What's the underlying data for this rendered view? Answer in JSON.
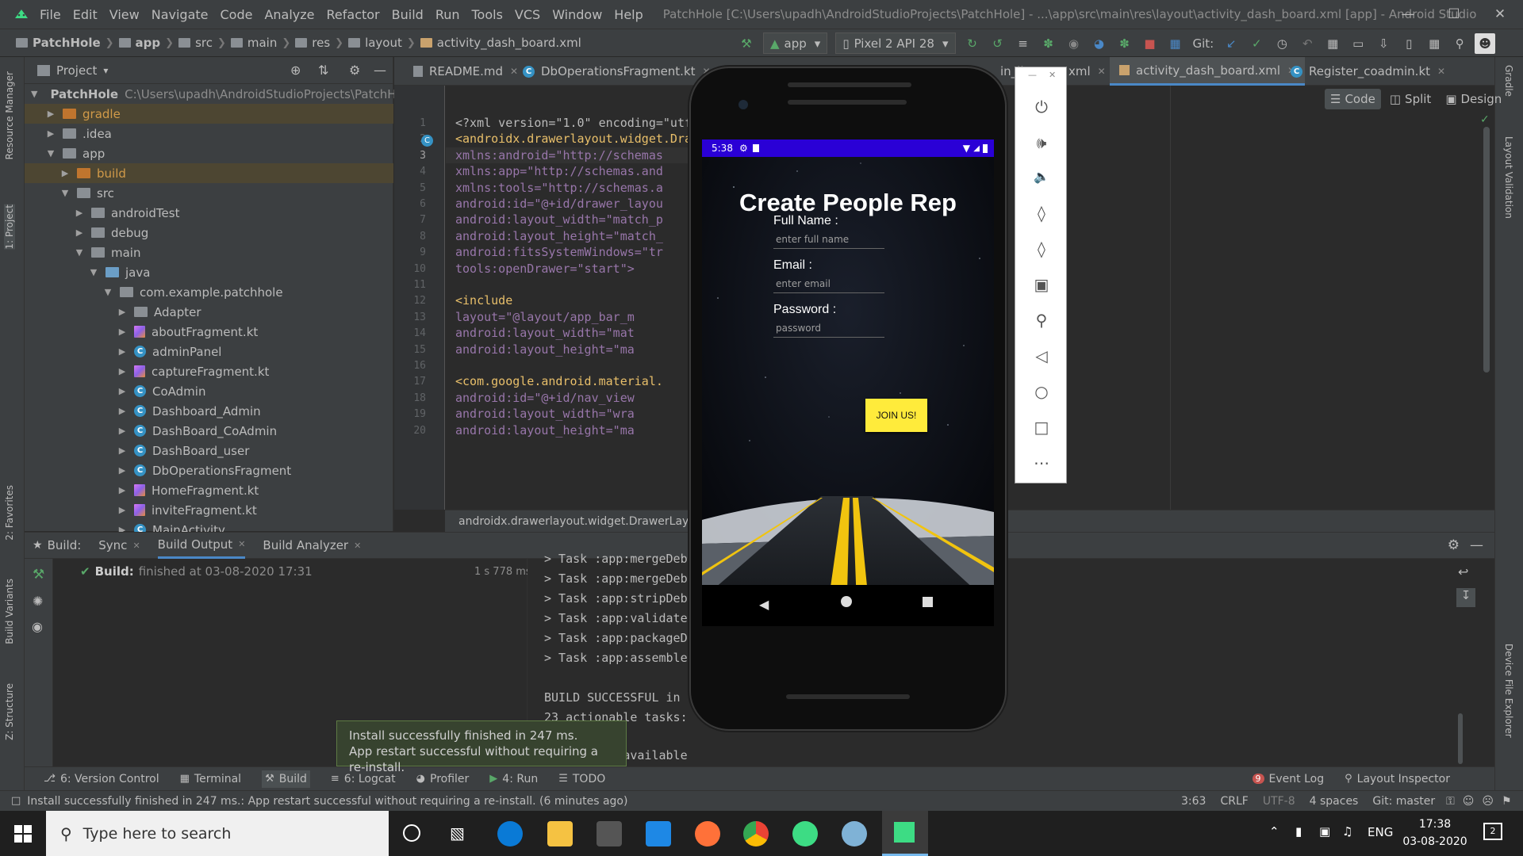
{
  "window": {
    "title": "PatchHole [C:\\Users\\upadh\\AndroidStudioProjects\\PatchHole] - ...\\app\\src\\main\\res\\layout\\activity_dash_board.xml [app] - Android Studio",
    "menu": [
      "File",
      "Edit",
      "View",
      "Navigate",
      "Code",
      "Analyze",
      "Refactor",
      "Build",
      "Run",
      "Tools",
      "VCS",
      "Window",
      "Help"
    ]
  },
  "navbar": {
    "crumbs": [
      "PatchHole",
      "app",
      "src",
      "main",
      "res",
      "layout",
      "activity_dash_board.xml"
    ],
    "run_config": "app",
    "device": "Pixel 2 API 28",
    "git_label": "Git:"
  },
  "left_strip": {
    "resource_manager": "Resource Manager",
    "project": "1: Project",
    "favorites": "2: Favorites",
    "build_variants": "Build Variants",
    "structure": "Z: Structure"
  },
  "right_strip": {
    "gradle": "Gradle",
    "layout_validation": "Layout Validation",
    "device_file_explorer": "Device File Explorer"
  },
  "project_panel": {
    "title": "Project",
    "root_name": "PatchHole",
    "root_path": "C:\\Users\\upadh\\AndroidStudioProjects\\PatchHc",
    "items": [
      {
        "label": "gradle",
        "indent": 1
      },
      {
        "label": ".idea",
        "indent": 1
      },
      {
        "label": "app",
        "indent": 1
      },
      {
        "label": "build",
        "indent": 2
      },
      {
        "label": "src",
        "indent": 2
      },
      {
        "label": "androidTest",
        "indent": 3
      },
      {
        "label": "debug",
        "indent": 3
      },
      {
        "label": "main",
        "indent": 3
      },
      {
        "label": "java",
        "indent": 4
      },
      {
        "label": "com.example.patchhole",
        "indent": 5
      },
      {
        "label": "Adapter",
        "indent": 6
      },
      {
        "label": "aboutFragment.kt",
        "indent": 6
      },
      {
        "label": "adminPanel",
        "indent": 6
      },
      {
        "label": "captureFragment.kt",
        "indent": 6
      },
      {
        "label": "CoAdmin",
        "indent": 6
      },
      {
        "label": "Dashboard_Admin",
        "indent": 6
      },
      {
        "label": "DashBoard_CoAdmin",
        "indent": 6
      },
      {
        "label": "DashBoard_user",
        "indent": 6
      },
      {
        "label": "DbOperationsFragment",
        "indent": 6
      },
      {
        "label": "HomeFragment.kt",
        "indent": 6
      },
      {
        "label": "inviteFragment.kt",
        "indent": 6
      },
      {
        "label": "MainActivity",
        "indent": 6
      }
    ]
  },
  "editor_tabs": [
    {
      "label": "README.md"
    },
    {
      "label": "DbOperationsFragment.kt"
    },
    {
      "label": "in_li"
    },
    {
      "label": "xml"
    },
    {
      "label": "activity_dash_board.xml"
    },
    {
      "label": "Register_coadmin.kt"
    }
  ],
  "view_modes": [
    "Code",
    "Split",
    "Design"
  ],
  "code_lines": [
    {
      "n": "1",
      "text": "<?xml version=\"1.0\" encoding=\"utf"
    },
    {
      "n": "2",
      "text": "<androidx.drawerlayout.widget.Dra"
    },
    {
      "n": "3",
      "text": "    xmlns:android=\"http://schemas"
    },
    {
      "n": "4",
      "text": "    xmlns:app=\"http://schemas.and"
    },
    {
      "n": "5",
      "text": "    xmlns:tools=\"http://schemas.a"
    },
    {
      "n": "6",
      "text": "    android:id=\"@+id/drawer_layou"
    },
    {
      "n": "7",
      "text": "    android:layout_width=\"match_p"
    },
    {
      "n": "8",
      "text": "    android:layout_height=\"match_"
    },
    {
      "n": "9",
      "text": "    android:fitsSystemWindows=\"tr"
    },
    {
      "n": "10",
      "text": "    tools:openDrawer=\"start\">"
    },
    {
      "n": "11",
      "text": ""
    },
    {
      "n": "12",
      "text": "    <include"
    },
    {
      "n": "13",
      "text": "        layout=\"@layout/app_bar_m"
    },
    {
      "n": "14",
      "text": "        android:layout_width=\"mat"
    },
    {
      "n": "15",
      "text": "        android:layout_height=\"ma"
    },
    {
      "n": "16",
      "text": ""
    },
    {
      "n": "17",
      "text": "    <com.google.android.material."
    },
    {
      "n": "18",
      "text": "        android:id=\"@+id/nav_view"
    },
    {
      "n": "19",
      "text": "        android:layout_width=\"wra"
    },
    {
      "n": "20",
      "text": "        android:layout_height=\"ma"
    }
  ],
  "editor_breadcrumb": "androidx.drawerlayout.widget.DrawerLayou",
  "build_panel": {
    "label": "Build:",
    "tabs": [
      "Sync",
      "Build Output",
      "Build Analyzer"
    ],
    "status_bold": "Build:",
    "status_rest": "finished at 03-08-2020 17:31",
    "duration": "1 s 778 ms",
    "output": [
      "> Task :app:mergeDeb",
      "> Task :app:mergeDebu",
      "> Task :app:stripDebu",
      "> Task :app:validate",
      "> Task :app:packageDe",
      "> Task :app:assemble",
      "",
      "BUILD SUCCESSFUL in",
      "23 actionable tasks:"
    ],
    "last_line_link": "er",
    "last_line_rest": " results available"
  },
  "balloon": {
    "line1": "Install successfully finished in 247 ms.",
    "line2": "App restart successful without requiring a re-install."
  },
  "bottom_tools": [
    {
      "label": "6: Version Control",
      "icon": "git-icon"
    },
    {
      "label": "Terminal",
      "icon": "terminal-icon"
    },
    {
      "label": "Build",
      "icon": "hammer-icon"
    },
    {
      "label": "6: Logcat",
      "icon": "logcat-icon"
    },
    {
      "label": "Profiler",
      "icon": "profiler-icon"
    },
    {
      "label": "4: Run",
      "icon": "run-icon"
    },
    {
      "label": "TODO",
      "icon": "todo-icon"
    }
  ],
  "bottom_right_tools": [
    {
      "label": "Event Log",
      "badge": "9"
    },
    {
      "label": "Layout Inspector"
    }
  ],
  "statusbar": {
    "message": "Install successfully finished in 247 ms.: App restart successful without requiring a re-install. (6 minutes ago)",
    "position": "3:63",
    "line_sep": "CRLF",
    "encoding": "UTF-8",
    "indent": "4 spaces",
    "git": "Git: master"
  },
  "phone": {
    "time": "5:38",
    "heading": "Create People Rep",
    "fields": [
      {
        "label": "Full Name :",
        "placeholder": "enter full name"
      },
      {
        "label": "Email :",
        "placeholder": "enter email"
      },
      {
        "label": "Password :",
        "placeholder": "password"
      }
    ],
    "button": "JOIN US!"
  },
  "taskbar": {
    "search_placeholder": "Type here to search",
    "lang": "ENG",
    "time": "17:38",
    "date": "03-08-2020",
    "notif_count": "2"
  },
  "colors": {
    "ide_bg": "#2b2b2b",
    "panel_bg": "#3c3f41",
    "phone_status": "#2a00d6",
    "join_button": "#ffeb3b",
    "build_success": "#59a869"
  }
}
